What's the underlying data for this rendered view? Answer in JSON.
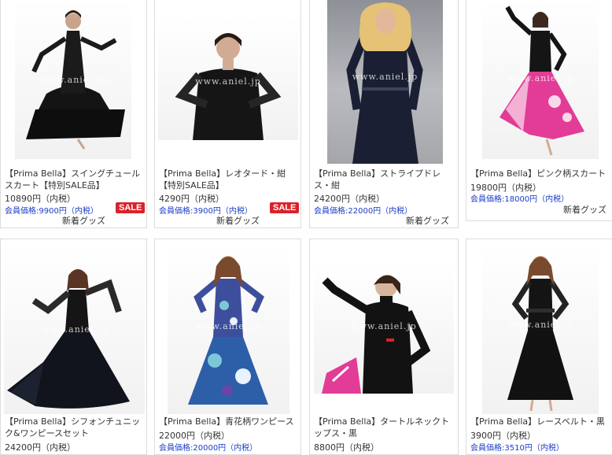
{
  "watermark": "www.aniel.jp",
  "products": [
    {
      "title": "【Prima Bella】スイングチュールスカート【特別SALE品】",
      "price": "10890円（内税）",
      "member_price": "会員価格:9900円（内税）",
      "badge": "SALE",
      "tag": "新着グッズ"
    },
    {
      "title": "【Prima Bella】レオタード・紺【特別SALE品】",
      "price": "4290円（内税）",
      "member_price": "会員価格:3900円（内税）",
      "badge": "SALE",
      "tag": "新着グッズ"
    },
    {
      "title": "【Prima Bella】ストライプドレス・紺",
      "price": "24200円（内税）",
      "member_price": "会員価格:22000円（内税）",
      "tag": "新着グッズ"
    },
    {
      "title": "【Prima Bella】ピンク柄スカート",
      "price": "19800円（内税）",
      "member_price": "会員価格:18000円（内税）",
      "tag": "新着グッズ"
    },
    {
      "title": "【Prima Bella】シフォンチュニック&ワンピースセット",
      "price": "24200円（内税）"
    },
    {
      "title": "【Prima Bella】青花柄ワンピース",
      "price": "22000円（内税）",
      "member_price": "会員価格:20000円（内税）"
    },
    {
      "title": "【Prima Bella】タートルネックトップス・黒",
      "price": "8800円（内税）"
    },
    {
      "title": "【Prima Bella】レースベルト・黒",
      "price": "3900円（内税）",
      "member_price": "会員価格:3510円（内税）"
    }
  ],
  "colors": {
    "member_price": "#1a3cc6",
    "sale_badge": "#d9222a",
    "border": "#dcdcdc"
  }
}
